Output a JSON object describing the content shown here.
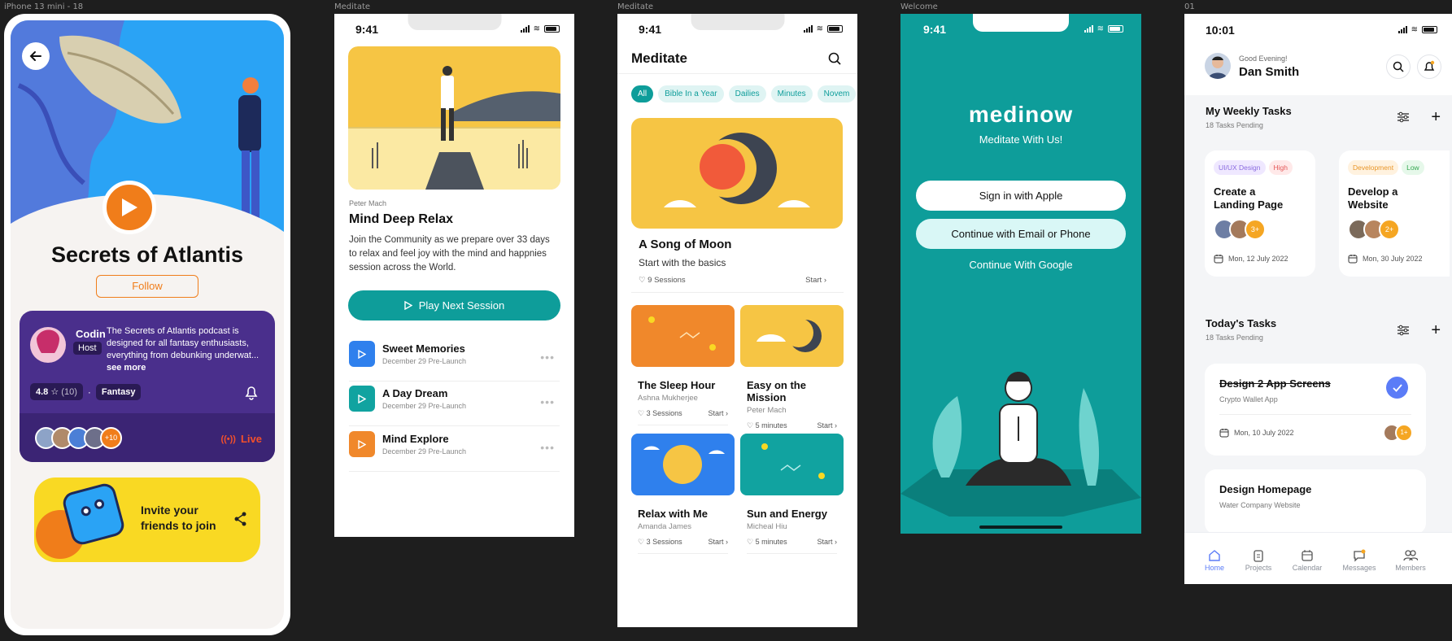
{
  "frames": {
    "f1": "iPhone 13 mini - 18",
    "f2": "Meditate",
    "f3": "Meditate",
    "f4": "Welcome",
    "f5": "01"
  },
  "podcast": {
    "title": "Secrets of Atlantis",
    "follow": "Follow",
    "host_name": "Codin",
    "host_role": "Host",
    "description": "The Secrets of Atlantis podcast is designed for all fantasy enthusiasts, everything from debunking underwat...",
    "see_more": "see more",
    "rating": "4.8",
    "rating_count": "(10)",
    "dot": "·",
    "genre": "Fantasy",
    "more_listeners": "+10",
    "live": "Live",
    "invite": "Invite your friends to join",
    "colors": {
      "orange": "#f07d1a",
      "purple": "#4a2f8c",
      "yellow": "#f9d923",
      "sky": "#2aa3f5"
    }
  },
  "meditate1": {
    "time": "9:41",
    "author": "Peter Mach",
    "title": "Mind Deep Relax",
    "description": "Join the Community as we prepare over 33 days to relax and feel joy with the mind and happnies session across the World.",
    "play_button": "Play Next Session",
    "sessions": [
      {
        "title": "Sweet Memories",
        "date": "December 29 Pre-Launch",
        "color": "#2f80ed"
      },
      {
        "title": "A Day Dream",
        "date": "December 29 Pre-Launch",
        "color": "#11a3a0"
      },
      {
        "title": "Mind Explore",
        "date": "December 29 Pre-Launch",
        "color": "#f0882b"
      }
    ],
    "accent": "#0e9d9a"
  },
  "meditate2": {
    "time": "9:41",
    "header": "Meditate",
    "filters": [
      "All",
      "Bible In a Year",
      "Dailies",
      "Minutes",
      "Novem"
    ],
    "featured": {
      "title": "A Song of Moon",
      "subtitle": "Start with the basics",
      "sessions": "9 Sessions",
      "start": "Start"
    },
    "cards": [
      {
        "title": "The Sleep Hour",
        "author": "Ashna Mukherjee",
        "meta": "3 Sessions",
        "start": "Start",
        "bg": "#f0882b"
      },
      {
        "title": "Easy on the Mission",
        "author": "Peter Mach",
        "meta": "5 minutes",
        "start": "Start",
        "bg": "#f6c544"
      },
      {
        "title": "Relax with Me",
        "author": "Amanda James",
        "meta": "3 Sessions",
        "start": "Start",
        "bg": "#2f80ed"
      },
      {
        "title": "Sun and Energy",
        "author": "Micheal Hiu",
        "meta": "5 minutes",
        "start": "Start",
        "bg": "#11a3a0"
      }
    ]
  },
  "welcome": {
    "time": "9:41",
    "brand": "medinow",
    "tagline": "Meditate With Us!",
    "apple": "Sign in with Apple",
    "email": "Continue with Email or Phone",
    "google": "Continue With Google",
    "bg": "#0e9d9a"
  },
  "tasks": {
    "time": "10:01",
    "greeting": "Good Evening!",
    "user": "Dan Smith",
    "weekly": {
      "title": "My Weekly Tasks",
      "pending": "18 Tasks Pending"
    },
    "weekly_cards": [
      {
        "tag1": "UI/UX Design",
        "tag2": "High",
        "title": "Create a Landing Page",
        "more": "3+",
        "date": "Mon, 12 July 2022"
      },
      {
        "tag1": "Development",
        "tag2": "Low",
        "title": "Develop a Website",
        "more": "2+",
        "date": "Mon, 30 July 2022"
      }
    ],
    "today": {
      "title": "Today's Tasks",
      "pending": "18 Tasks Pending"
    },
    "today_cards": [
      {
        "title": "Design 2 App Screens",
        "subtitle": "Crypto Wallet App",
        "date": "Mon, 10 July 2022",
        "more": "1+"
      },
      {
        "title": "Design Homepage",
        "subtitle": "Water Company Website"
      }
    ],
    "nav": [
      "Home",
      "Projects",
      "Calendar",
      "Messages",
      "Members"
    ],
    "accent": "#5b7cf7"
  }
}
